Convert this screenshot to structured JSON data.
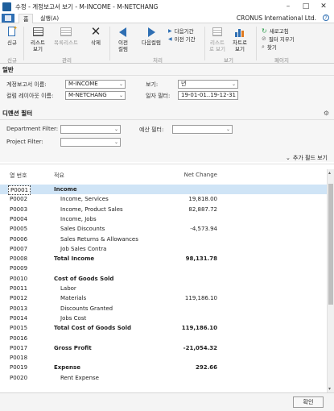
{
  "window": {
    "title": "수정 - 계정보고서 보기 - M-INCOME - M-NETCHANG"
  },
  "ribbon_tabs": {
    "home": "홈",
    "actions": "실행(A)"
  },
  "company": "CRONUS International Ltd.",
  "ribbon": {
    "new": "신규",
    "list_view": "리스트\n보기",
    "edit_list": "목록리스트",
    "delete": "삭제",
    "prev_column": "이전\n컬럼",
    "next_column": "다음컬럼",
    "next_period": "다음기간",
    "prev_period": "이전 기간",
    "list_view_disabled": "리스트\n로 보기",
    "chart_view": "차트로\n보기",
    "refresh": "새로고침",
    "clear_filter": "필터 지우기",
    "find": "찾기",
    "groups": {
      "new": "신규",
      "manage": "관리",
      "process": "처리",
      "view": "보기",
      "page": "페이지"
    }
  },
  "general": {
    "title": "일반",
    "acc_schedule_label": "계정보고서 이름:",
    "acc_schedule_value": "M-INCOME",
    "column_layout_label": "컬럼 레이아웃 이름:",
    "column_layout_value": "M-NETCHANG",
    "view_label": "보기:",
    "view_value": "년",
    "date_filter_label": "일자 필터:",
    "date_filter_value": "19-01-01..19-12-31"
  },
  "dimension": {
    "title": "디멘션 필터",
    "department_label": "Department Filter:",
    "budget_label": "예산 필터:",
    "project_label": "Project Filter:",
    "more_filters": "추가 필드 보기"
  },
  "grid": {
    "col_no": "열 번호",
    "col_desc": "적요",
    "col_net": "Net Change",
    "rows": [
      {
        "code": "P0001",
        "desc": "Income",
        "value": "",
        "bold": true,
        "indent": false
      },
      {
        "code": "P0002",
        "desc": "Income, Services",
        "value": "19,818.00",
        "bold": false,
        "indent": true
      },
      {
        "code": "P0003",
        "desc": "Income, Product Sales",
        "value": "82,887.72",
        "bold": false,
        "indent": true
      },
      {
        "code": "P0004",
        "desc": "Income, Jobs",
        "value": "",
        "bold": false,
        "indent": true
      },
      {
        "code": "P0005",
        "desc": "Sales Discounts",
        "value": "-4,573.94",
        "bold": false,
        "indent": true
      },
      {
        "code": "P0006",
        "desc": "Sales Returns & Allowances",
        "value": "",
        "bold": false,
        "indent": true
      },
      {
        "code": "P0007",
        "desc": "Job Sales Contra",
        "value": "",
        "bold": false,
        "indent": true
      },
      {
        "code": "P0008",
        "desc": "Total Income",
        "value": "98,131.78",
        "bold": true,
        "indent": false
      },
      {
        "code": "P0009",
        "desc": "",
        "value": "",
        "bold": false,
        "indent": false
      },
      {
        "code": "P0010",
        "desc": "Cost of Goods Sold",
        "value": "",
        "bold": true,
        "indent": false
      },
      {
        "code": "P0011",
        "desc": "Labor",
        "value": "",
        "bold": false,
        "indent": true
      },
      {
        "code": "P0012",
        "desc": "Materials",
        "value": "119,186.10",
        "bold": false,
        "indent": true
      },
      {
        "code": "P0013",
        "desc": "Discounts Granted",
        "value": "",
        "bold": false,
        "indent": true
      },
      {
        "code": "P0014",
        "desc": "Jobs Cost",
        "value": "",
        "bold": false,
        "indent": true
      },
      {
        "code": "P0015",
        "desc": "Total Cost of Goods Sold",
        "value": "119,186.10",
        "bold": true,
        "indent": false
      },
      {
        "code": "P0016",
        "desc": "",
        "value": "",
        "bold": false,
        "indent": false
      },
      {
        "code": "P0017",
        "desc": "Gross Profit",
        "value": "-21,054.32",
        "bold": true,
        "indent": false
      },
      {
        "code": "P0018",
        "desc": "",
        "value": "",
        "bold": false,
        "indent": false
      },
      {
        "code": "P0019",
        "desc": "Expense",
        "value": "292.66",
        "bold": true,
        "indent": false
      },
      {
        "code": "P0020",
        "desc": "Rent Expense",
        "value": "",
        "bold": false,
        "indent": true
      }
    ]
  },
  "footer": {
    "ok": "확인"
  }
}
